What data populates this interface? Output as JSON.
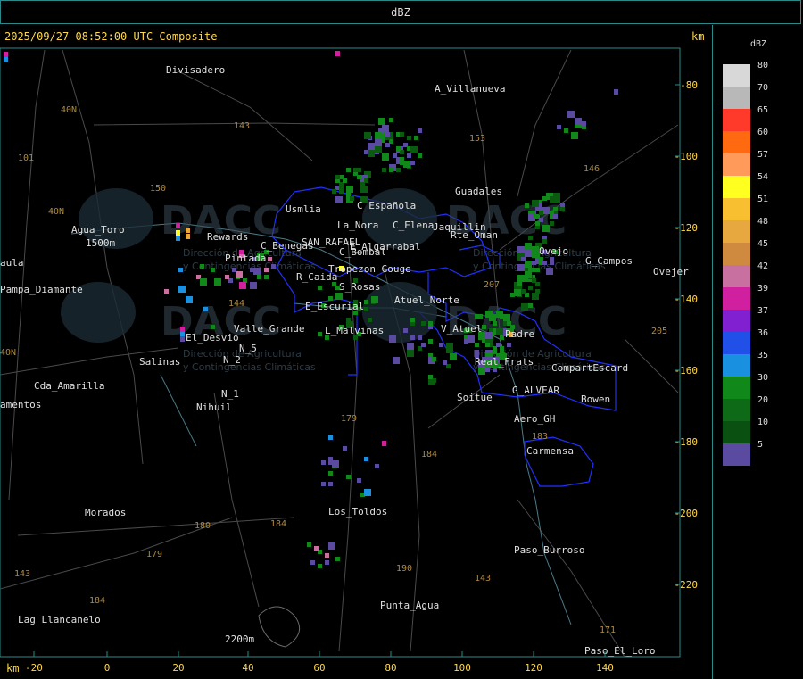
{
  "topbar": {
    "title": "dBZ"
  },
  "header": {
    "timestamp": "2025/09/27 08:52:00 UTC Composite",
    "km_right": "km",
    "km_bottom": "km"
  },
  "axes": {
    "x_ticks": [
      "-20",
      "0",
      "20",
      "40",
      "60",
      "80",
      "100",
      "120",
      "140"
    ],
    "y_ticks": [
      "-80",
      "-100",
      "-120",
      "-140",
      "-160",
      "-180",
      "-200",
      "-220"
    ]
  },
  "legend": {
    "title": "dBZ",
    "items": [
      {
        "label": "80",
        "color": "#d8d8d8"
      },
      {
        "label": "70",
        "color": "#b8b8b8"
      },
      {
        "label": "65",
        "color": "#ff3a2a"
      },
      {
        "label": "60",
        "color": "#ff6a10"
      },
      {
        "label": "57",
        "color": "#ff9a5a"
      },
      {
        "label": "54",
        "color": "#ffff20"
      },
      {
        "label": "51",
        "color": "#f8c030"
      },
      {
        "label": "48",
        "color": "#e8a840"
      },
      {
        "label": "45",
        "color": "#d08a40"
      },
      {
        "label": "42",
        "color": "#c870a0"
      },
      {
        "label": "39",
        "color": "#d020a0"
      },
      {
        "label": "37",
        "color": "#8020d0"
      },
      {
        "label": "36",
        "color": "#2050e8"
      },
      {
        "label": "35",
        "color": "#1a90e0"
      },
      {
        "label": "30",
        "color": "#10881a"
      },
      {
        "label": "20",
        "color": "#0e6a16"
      },
      {
        "label": "10",
        "color": "#0a5010"
      },
      {
        "label": "5",
        "color": "#5a4aa0"
      }
    ]
  },
  "places": [
    {
      "name": "Divisadero"
    },
    {
      "name": "A_Villanueva"
    },
    {
      "name": "Guadales"
    },
    {
      "name": "Agua_Toro"
    },
    {
      "name": "Usmlia"
    },
    {
      "name": "C_Española"
    },
    {
      "name": "La_Nora"
    },
    {
      "name": "C_Elena"
    },
    {
      "name": "Jaquillin"
    },
    {
      "name": "Rte_Oman"
    },
    {
      "name": "SAN_RAFAEL"
    },
    {
      "name": "Rewards"
    },
    {
      "name": "C_Bombal"
    },
    {
      "name": "E_Algarrabal"
    },
    {
      "name": "Pintada"
    },
    {
      "name": "C_Benegas"
    },
    {
      "name": "Tropezon Gouge"
    },
    {
      "name": "R_Caida"
    },
    {
      "name": "S_Rosas"
    },
    {
      "name": "G_Campos"
    },
    {
      "name": "Ovejer"
    },
    {
      "name": "Pampa_Diamante"
    },
    {
      "name": "Ovejo"
    },
    {
      "name": "Atuel_Norte"
    },
    {
      "name": "E_Escurial"
    },
    {
      "name": "Valle_Grande"
    },
    {
      "name": "L_Malvinas"
    },
    {
      "name": "V_Atuel"
    },
    {
      "name": "Padre"
    },
    {
      "name": "El_Desvio"
    },
    {
      "name": "Salinas"
    },
    {
      "name": "N_2"
    },
    {
      "name": "N_5"
    },
    {
      "name": "CompartEscard"
    },
    {
      "name": "Real_Frats"
    },
    {
      "name": "Cda_Amarilla"
    },
    {
      "name": "N_1"
    },
    {
      "name": "Nihuil"
    },
    {
      "name": "Soitue"
    },
    {
      "name": "G_ALVEAR"
    },
    {
      "name": "Bowen"
    },
    {
      "name": "amentos"
    },
    {
      "name": "Aero_GH"
    },
    {
      "name": "Carmensa"
    },
    {
      "name": "Morados"
    },
    {
      "name": "Los_Toldos"
    },
    {
      "name": "Paso_Burroso"
    },
    {
      "name": "Punta_Agua"
    },
    {
      "name": "Lag_Llancanelo"
    },
    {
      "name": "Paso_El_Loro"
    },
    {
      "name": "2200m"
    },
    {
      "name": "1500m"
    },
    {
      "name": "aula"
    }
  ],
  "roads": [
    "40N",
    "101",
    "150",
    "143",
    "153",
    "146",
    "40N",
    "144",
    "40N",
    "205",
    "179",
    "184",
    "180",
    "184",
    "179",
    "190",
    "143",
    "183",
    "184",
    "143",
    "171",
    "207"
  ],
  "watermark": {
    "brand": "DACC",
    "line1": "Dirección de Agricultura",
    "line2": "y Contingencias Climáticas"
  },
  "echo_colors": {
    "green": "#10881a",
    "dark_green": "#0a5a10",
    "purple": "#5a4aa0",
    "magenta": "#d020a0",
    "blue": "#1a90e0",
    "yellow": "#ffff20",
    "orange": "#e8a840",
    "pink": "#c870a0"
  },
  "map_colors": {
    "axis": "#2a8a8a",
    "boundary": "#2030ff",
    "road": "#7a5a20",
    "river": "#4a7a8a",
    "terrain": "#555"
  }
}
